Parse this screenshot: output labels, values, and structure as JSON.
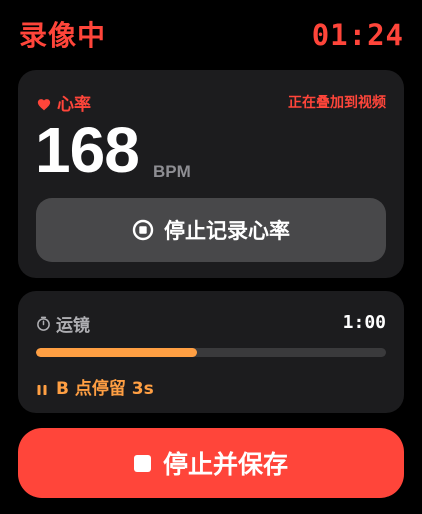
{
  "status_bar": {
    "recording_label": "录像中",
    "elapsed_time": "01:24"
  },
  "heart_rate": {
    "label": "心率",
    "overlay_status": "正在叠加到视频",
    "value": "168",
    "unit": "BPM",
    "stop_button_label": "停止记录心率",
    "icons": {
      "label_icon": "heart-icon",
      "button_icon": "stop-record-icon"
    }
  },
  "camera_move": {
    "label": "运镜",
    "duration": "1:00",
    "progress": 0.46,
    "status": "B 点停留 3s",
    "icons": {
      "label_icon": "timer-icon",
      "status_icon": "pause-icon"
    }
  },
  "save_button": {
    "label": "停止并保存",
    "icon": "stop-square-icon"
  },
  "colors": {
    "background": "#000000",
    "card": "#1c1c1e",
    "accent_red": "#ff453a",
    "accent_orange": "#ff9f43",
    "secondary_button": "#48484a",
    "muted_text": "#8e8e93"
  }
}
